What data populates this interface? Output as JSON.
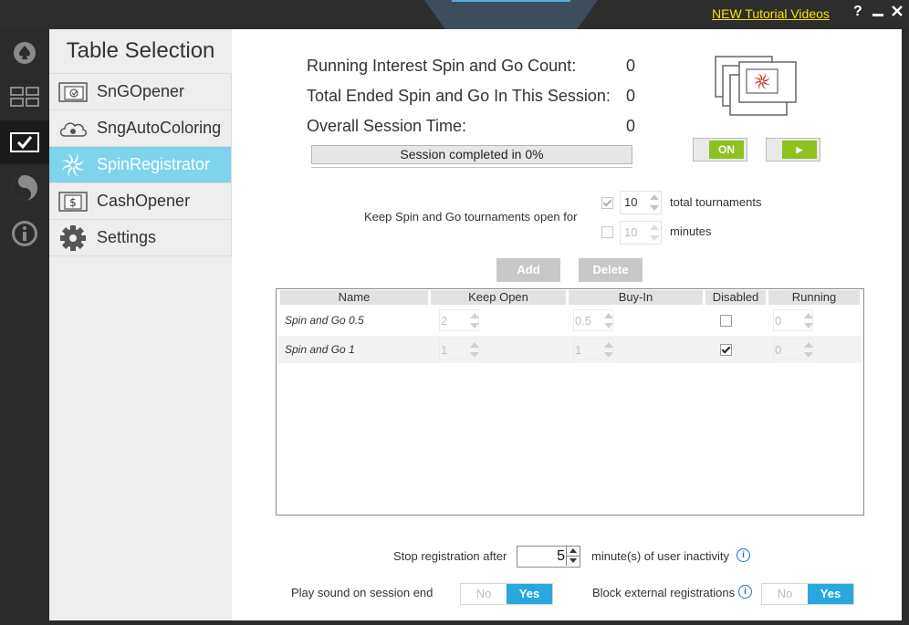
{
  "header": {
    "tutorial_link": "NEW Tutorial Videos",
    "help_label": "?",
    "minimize_label": "—",
    "close_label": "✕"
  },
  "rail": {
    "items": [
      "spade-icon",
      "grid-icon",
      "check-icon",
      "yin-yang-icon",
      "info-icon"
    ],
    "active_index": 2
  },
  "sidebar": {
    "title": "Table Selection",
    "items": [
      {
        "label": "SnGOpener",
        "icon": "sng-opener-icon"
      },
      {
        "label": "SngAutoColoring",
        "icon": "cloud-icon"
      },
      {
        "label": "SpinRegistrator",
        "icon": "spinner-icon"
      },
      {
        "label": "CashOpener",
        "icon": "dollar-icon"
      },
      {
        "label": "Settings",
        "icon": "gear-icon"
      }
    ],
    "active_index": 2
  },
  "stats": {
    "running_label": "Running Interest Spin and Go Count:",
    "running_value": "0",
    "ended_label": "Total Ended Spin and Go In This Session:",
    "ended_value": "0",
    "time_label": "Overall Session Time:",
    "time_value": "0",
    "progress_text": "Session completed in 0%",
    "progress_fraction": 0
  },
  "controls": {
    "on_label": "ON",
    "play_label": "▶"
  },
  "keep_open": {
    "label": "Keep Spin and Go tournaments open for",
    "tournaments_value": "10",
    "tournaments_unit": "total tournaments",
    "tournaments_checked": true,
    "minutes_value": "10",
    "minutes_unit": "minutes",
    "minutes_checked": false
  },
  "buttons": {
    "add": "Add",
    "delete": "Delete"
  },
  "table": {
    "headers": [
      "Name",
      "Keep Open",
      "Buy-In",
      "Disabled",
      "Running"
    ],
    "rows": [
      {
        "name": "Spin and Go 0.5",
        "keep_open": "2",
        "buy_in": "0.5",
        "disabled": false,
        "running": "0"
      },
      {
        "name": "Spin and Go 1",
        "keep_open": "1",
        "buy_in": "1",
        "disabled": true,
        "running": "0"
      }
    ]
  },
  "footer": {
    "stop_label": "Stop registration after",
    "stop_value": "5",
    "stop_unit": "minute(s) of user inactivity",
    "sound_label": "Play sound on session end",
    "block_label": "Block external registrations",
    "no_label": "No",
    "yes_label": "Yes",
    "sound_selected": "Yes",
    "block_selected": "Yes"
  },
  "colors": {
    "accent_green": "#8dc21f",
    "nav_active": "#7fd3ec",
    "yes_blue": "#29a8e0",
    "tutorial_yellow": "#f5e400",
    "info_blue": "#1a73c9"
  }
}
